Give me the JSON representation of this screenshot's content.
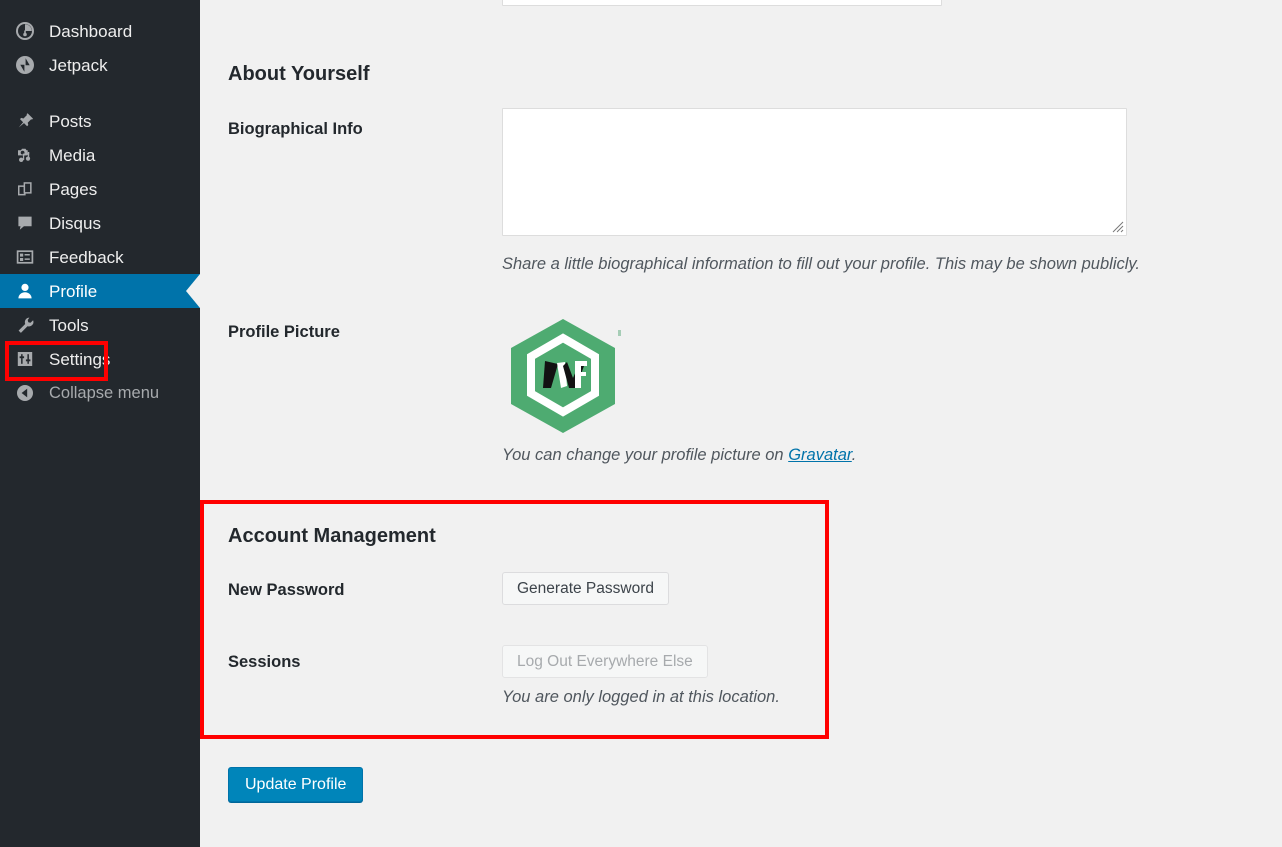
{
  "sidebar": {
    "items": [
      {
        "label": "Dashboard",
        "icon": "dashboard-icon",
        "active": false
      },
      {
        "label": "Jetpack",
        "icon": "jetpack-icon",
        "active": false
      },
      {
        "label": "Posts",
        "icon": "pin-icon",
        "active": false
      },
      {
        "label": "Media",
        "icon": "media-icon",
        "active": false
      },
      {
        "label": "Pages",
        "icon": "pages-icon",
        "active": false
      },
      {
        "label": "Disqus",
        "icon": "comment-icon",
        "active": false
      },
      {
        "label": "Feedback",
        "icon": "feedback-icon",
        "active": false
      },
      {
        "label": "Profile",
        "icon": "user-icon",
        "active": true
      },
      {
        "label": "Tools",
        "icon": "wrench-icon",
        "active": false
      },
      {
        "label": "Settings",
        "icon": "sliders-icon",
        "active": false
      },
      {
        "label": "Collapse menu",
        "icon": "collapse-left-icon",
        "active": false
      }
    ]
  },
  "main": {
    "about": {
      "heading": "About Yourself",
      "bio_label": "Biographical Info",
      "bio_value": "",
      "bio_description": "Share a little biographical information to fill out your profile. This may be shown publicly.",
      "picture_label": "Profile Picture",
      "picture_description_prefix": "You can change your profile picture on ",
      "picture_link": "Gravatar",
      "picture_description_suffix": ".",
      "avatar_icon": "wordpress-hexagon-avatar"
    },
    "account": {
      "heading": "Account Management",
      "password_label": "New Password",
      "generate_password_button": "Generate Password",
      "sessions_label": "Sessions",
      "logout_everywhere_button": "Log Out Everywhere Else",
      "sessions_note": "You are only logged in at this location."
    },
    "submit_button": "Update Profile"
  },
  "colors": {
    "sidebar_bg": "#23282d",
    "accent_blue": "#0073aa",
    "primary_button": "#0085ba",
    "highlight_red": "#ff0000",
    "avatar_green": "#4eab71",
    "page_bg": "#f1f1f1"
  }
}
